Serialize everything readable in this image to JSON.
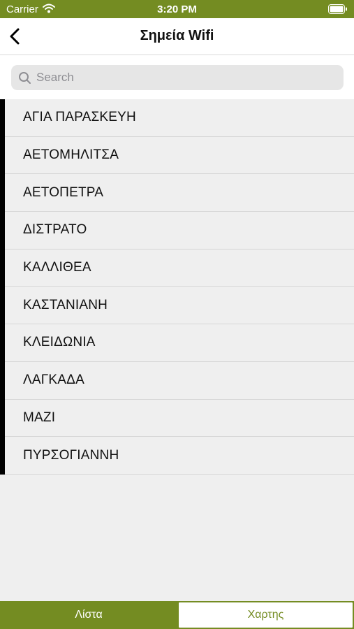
{
  "status_bar": {
    "carrier": "Carrier",
    "time": "3:20 PM",
    "icons": [
      "wifi-icon",
      "battery-icon"
    ]
  },
  "nav": {
    "title": "Σημεία Wifi",
    "back_icon": "chevron-left-icon"
  },
  "search": {
    "placeholder": "Search",
    "value": "",
    "icon": "search-icon"
  },
  "locations": [
    {
      "label": "ΑΓΙΑ ΠΑΡΑΣΚΕΥΗ"
    },
    {
      "label": "ΑΕΤΟΜΗΛΙΤΣΑ"
    },
    {
      "label": "ΑΕΤΟΠΕΤΡΑ"
    },
    {
      "label": "ΔΙΣΤΡΑΤΟ"
    },
    {
      "label": "ΚΑΛΛΙΘΕΑ"
    },
    {
      "label": "ΚΑΣΤΑΝΙΑΝΗ"
    },
    {
      "label": "ΚΛΕΙΔΩΝΙΑ"
    },
    {
      "label": "ΛΑΓΚΑΔΑ"
    },
    {
      "label": "ΜΑΖΙ"
    },
    {
      "label": "ΠΥΡΣΟΓΙΑΝΝΗ"
    }
  ],
  "tabs": {
    "list_label": "Λίστα",
    "map_label": "Χαρτης",
    "selected": "list"
  },
  "colors": {
    "accent": "#748c22",
    "background": "#efefef"
  }
}
